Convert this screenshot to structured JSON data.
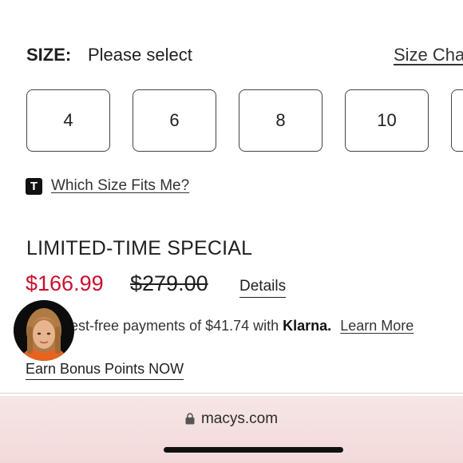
{
  "size": {
    "label": "SIZE:",
    "value": "Please select",
    "chart_link": "Size Chart",
    "options": [
      "4",
      "6",
      "8",
      "10"
    ]
  },
  "fit_link": "Which Size Fits Me?",
  "fit_badge": "T",
  "promo_label": "LIMITED-TIME SPECIAL",
  "price": {
    "sale": "$166.99",
    "original": "$279.00",
    "details_label": "Details"
  },
  "klarna": {
    "text": "est-free payments of $41.74 with",
    "brand": "Klarna.",
    "learn_more": "Learn More"
  },
  "bonus_link": "Earn Bonus Points NOW",
  "browser": {
    "url": "macys.com"
  },
  "colors": {
    "sale_price": "#c8102e",
    "browser_bar": "#f3d9da"
  }
}
